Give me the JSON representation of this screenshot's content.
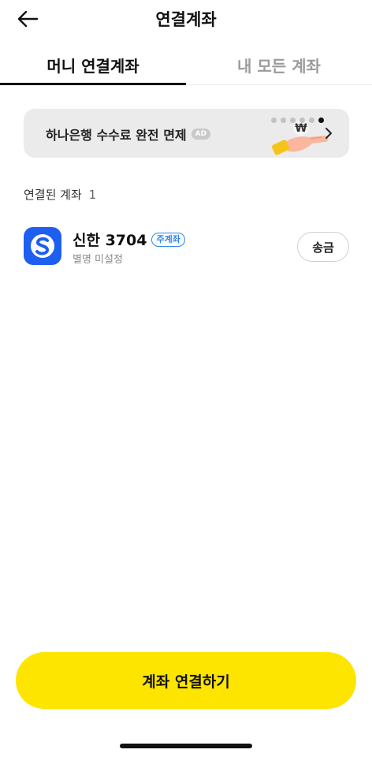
{
  "header": {
    "title": "연결계좌",
    "back_icon": "arrow-left-icon"
  },
  "tabs": [
    {
      "label": "머니 연결계좌",
      "active": true
    },
    {
      "label": "내 모든 계좌",
      "active": false
    }
  ],
  "banner": {
    "text": "하나은행 수수료 완전 면제",
    "ad_label": "AD",
    "illustration": "hand-coin-won-icon",
    "page_count": 6,
    "active_page": 6,
    "chevron_icon": "chevron-right-icon"
  },
  "section": {
    "label": "연결된 계좌",
    "count": "1"
  },
  "accounts": [
    {
      "bank_icon": "shinhan-bank-logo-icon",
      "name": "신한 3704",
      "badge": "주계좌",
      "subtitle": "별명 미설정",
      "action": "송금"
    }
  ],
  "connect_button": "계좌 연결하기",
  "colors": {
    "accent": "#FEE500",
    "bank_blue": "#1E5EF0",
    "badge_blue": "#2D87E8"
  }
}
